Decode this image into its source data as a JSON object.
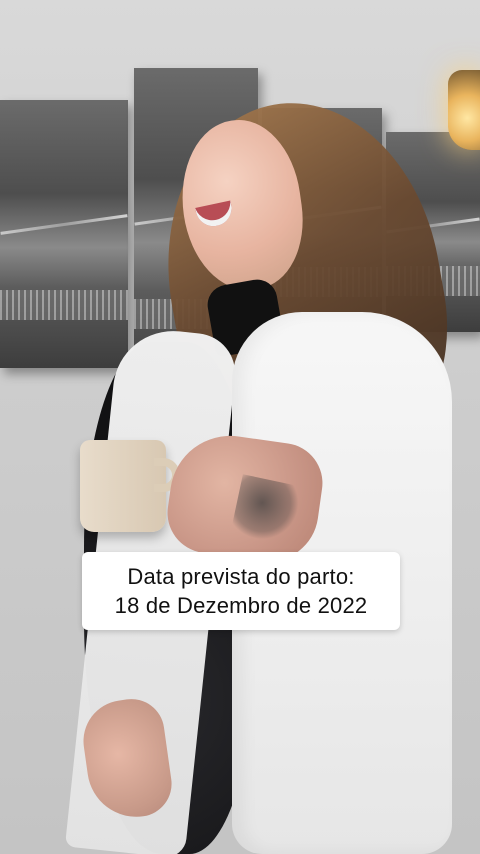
{
  "overlay": {
    "caption_lines": [
      "Data prevista do parto:",
      "18 de Dezembro de 2022"
    ]
  },
  "colors": {
    "caption_background": "#ffffff",
    "caption_text": "#111111"
  }
}
